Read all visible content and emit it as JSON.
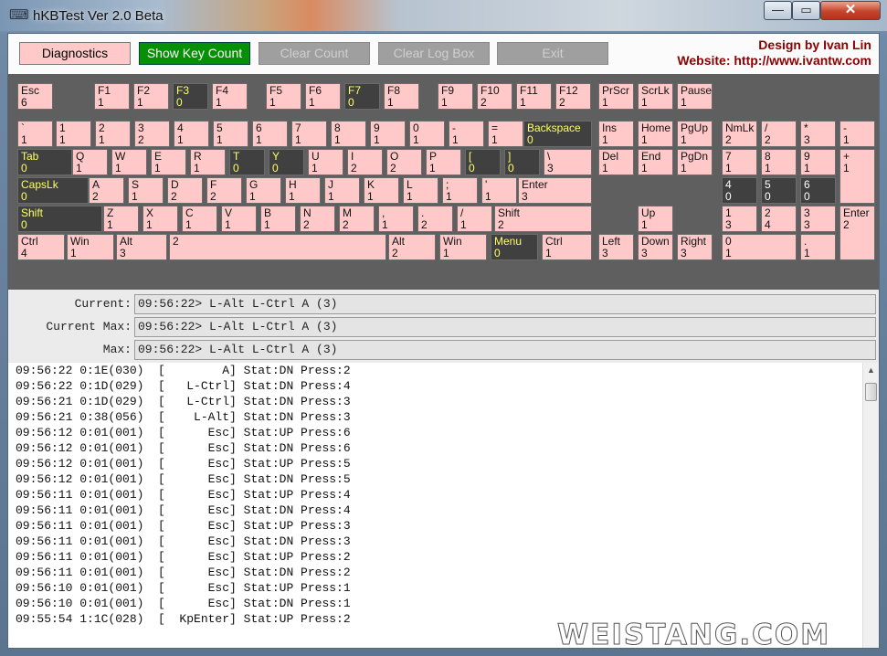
{
  "window": {
    "title": "hKBTest Ver 2.0 Beta",
    "minimize": "—",
    "maximize": "▭",
    "close": "✕",
    "icon": "keyboard-icon"
  },
  "toolbar": {
    "diagnostics": "Diagnostics",
    "show_key_count": "Show Key Count",
    "clear_count": "Clear Count",
    "clear_log_box": "Clear Log Box",
    "exit": "Exit"
  },
  "credit": {
    "line1": "Design by Ivan Lin",
    "line2": "Website: http://www.ivantw.com"
  },
  "keys": [
    {
      "n": "Esc",
      "c": "6"
    },
    {
      "n": "F1",
      "c": "1"
    },
    {
      "n": "F2",
      "c": "1"
    },
    {
      "n": "F3",
      "c": "0"
    },
    {
      "n": "F4",
      "c": "1"
    },
    {
      "n": "F5",
      "c": "1"
    },
    {
      "n": "F6",
      "c": "1"
    },
    {
      "n": "F7",
      "c": "0"
    },
    {
      "n": "F8",
      "c": "1"
    },
    {
      "n": "F9",
      "c": "1"
    },
    {
      "n": "F10",
      "c": "2"
    },
    {
      "n": "F11",
      "c": "1"
    },
    {
      "n": "F12",
      "c": "2"
    },
    {
      "n": "PrScr",
      "c": "1"
    },
    {
      "n": "ScrLk",
      "c": "1"
    },
    {
      "n": "Pause",
      "c": "1"
    },
    {
      "n": "`",
      "c": "1"
    },
    {
      "n": "1",
      "c": "1"
    },
    {
      "n": "2",
      "c": "1"
    },
    {
      "n": "3",
      "c": "2"
    },
    {
      "n": "4",
      "c": "1"
    },
    {
      "n": "5",
      "c": "1"
    },
    {
      "n": "6",
      "c": "1"
    },
    {
      "n": "7",
      "c": "1"
    },
    {
      "n": "8",
      "c": "1"
    },
    {
      "n": "9",
      "c": "1"
    },
    {
      "n": "0",
      "c": "1"
    },
    {
      "n": "-",
      "c": "1"
    },
    {
      "n": "=",
      "c": "1"
    },
    {
      "n": "Backspace",
      "c": "0"
    },
    {
      "n": "Ins",
      "c": "1"
    },
    {
      "n": "Home",
      "c": "1"
    },
    {
      "n": "PgUp",
      "c": "1"
    },
    {
      "n": "NmLk",
      "c": "2"
    },
    {
      "n": "/",
      "c": "2"
    },
    {
      "n": "*",
      "c": "3"
    },
    {
      "n": "-",
      "c": "1"
    },
    {
      "n": "Tab",
      "c": "0"
    },
    {
      "n": "Q",
      "c": "1"
    },
    {
      "n": "W",
      "c": "1"
    },
    {
      "n": "E",
      "c": "1"
    },
    {
      "n": "R",
      "c": "1"
    },
    {
      "n": "T",
      "c": "0"
    },
    {
      "n": "Y",
      "c": "0"
    },
    {
      "n": "U",
      "c": "1"
    },
    {
      "n": "I",
      "c": "2"
    },
    {
      "n": "O",
      "c": "2"
    },
    {
      "n": "P",
      "c": "1"
    },
    {
      "n": "[",
      "c": "0"
    },
    {
      "n": "]",
      "c": "0"
    },
    {
      "n": "\\",
      "c": "3"
    },
    {
      "n": "Del",
      "c": "1"
    },
    {
      "n": "End",
      "c": "1"
    },
    {
      "n": "PgDn",
      "c": "1"
    },
    {
      "n": "7",
      "c": "1"
    },
    {
      "n": "8",
      "c": "1"
    },
    {
      "n": "9",
      "c": "1"
    },
    {
      "n": "+",
      "c": "1"
    },
    {
      "n": "CapsLk",
      "c": "0"
    },
    {
      "n": "A",
      "c": "2"
    },
    {
      "n": "S",
      "c": "1"
    },
    {
      "n": "D",
      "c": "2"
    },
    {
      "n": "F",
      "c": "2"
    },
    {
      "n": "G",
      "c": "1"
    },
    {
      "n": "H",
      "c": "1"
    },
    {
      "n": "J",
      "c": "1"
    },
    {
      "n": "K",
      "c": "1"
    },
    {
      "n": "L",
      "c": "1"
    },
    {
      "n": ";",
      "c": "1"
    },
    {
      "n": "'",
      "c": "1"
    },
    {
      "n": "Enter",
      "c": "3"
    },
    {
      "n": "4",
      "c": "0"
    },
    {
      "n": "5",
      "c": "0"
    },
    {
      "n": "6",
      "c": "0"
    },
    {
      "n": "Shift",
      "c": "0"
    },
    {
      "n": "Z",
      "c": "1"
    },
    {
      "n": "X",
      "c": "1"
    },
    {
      "n": "C",
      "c": "1"
    },
    {
      "n": "V",
      "c": "1"
    },
    {
      "n": "B",
      "c": "1"
    },
    {
      "n": "N",
      "c": "2"
    },
    {
      "n": "M",
      "c": "2"
    },
    {
      "n": ",",
      "c": "1"
    },
    {
      "n": ".",
      "c": "2"
    },
    {
      "n": "/",
      "c": "1"
    },
    {
      "n": "Shift",
      "c": "2"
    },
    {
      "n": "Up",
      "c": "1"
    },
    {
      "n": "1",
      "c": "3"
    },
    {
      "n": "2",
      "c": "4"
    },
    {
      "n": "3",
      "c": "3"
    },
    {
      "n": "Enter",
      "c": "2"
    },
    {
      "n": "Ctrl",
      "c": "4"
    },
    {
      "n": "Win",
      "c": "1"
    },
    {
      "n": "Alt",
      "c": "3"
    },
    {
      "n": "",
      "c": "2"
    },
    {
      "n": "Alt",
      "c": "2"
    },
    {
      "n": "Win",
      "c": "1"
    },
    {
      "n": "Menu",
      "c": "0"
    },
    {
      "n": "Ctrl",
      "c": "1"
    },
    {
      "n": "Left",
      "c": "3"
    },
    {
      "n": "Down",
      "c": "3"
    },
    {
      "n": "Right",
      "c": "3"
    },
    {
      "n": "0",
      "c": "1"
    },
    {
      "n": ".",
      "c": "1"
    }
  ],
  "status": {
    "current_label": "Current:",
    "current": "09:56:22> L-Alt L-Ctrl A (3)",
    "current_max_label": "Current Max:",
    "current_max": "09:56:22> L-Alt L-Ctrl A (3)",
    "max_label": "Max:",
    "max": "09:56:22> L-Alt L-Ctrl A (3)"
  },
  "log": [
    "09:56:22 0:1E(030)  [        A] Stat:DN Press:2",
    "09:56:22 0:1D(029)  [   L-Ctrl] Stat:DN Press:4",
    "09:56:21 0:1D(029)  [   L-Ctrl] Stat:DN Press:3",
    "09:56:21 0:38(056)  [    L-Alt] Stat:DN Press:3",
    "09:56:12 0:01(001)  [      Esc] Stat:UP Press:6",
    "09:56:12 0:01(001)  [      Esc] Stat:DN Press:6",
    "09:56:12 0:01(001)  [      Esc] Stat:UP Press:5",
    "09:56:12 0:01(001)  [      Esc] Stat:DN Press:5",
    "09:56:11 0:01(001)  [      Esc] Stat:UP Press:4",
    "09:56:11 0:01(001)  [      Esc] Stat:DN Press:4",
    "09:56:11 0:01(001)  [      Esc] Stat:UP Press:3",
    "09:56:11 0:01(001)  [      Esc] Stat:DN Press:3",
    "09:56:11 0:01(001)  [      Esc] Stat:UP Press:2",
    "09:56:11 0:01(001)  [      Esc] Stat:DN Press:2",
    "09:56:10 0:01(001)  [      Esc] Stat:UP Press:1",
    "09:56:10 0:01(001)  [      Esc] Stat:DN Press:1",
    "09:55:54 1:1C(028)  [  KpEnter] Stat:UP Press:2"
  ],
  "scrollbar": {
    "up_arrow": "▲"
  },
  "watermark": "WEISTANG.COM"
}
